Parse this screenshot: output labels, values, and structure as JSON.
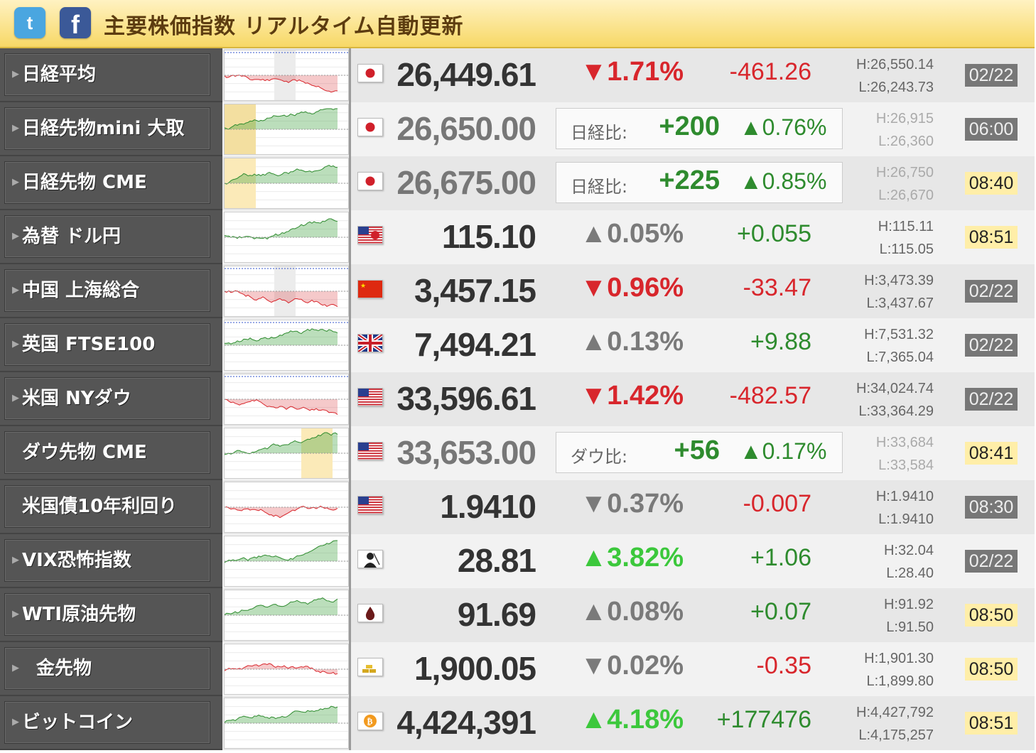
{
  "header": {
    "title": "主要株価指数 リアルタイム自動更新",
    "twitter_icon": "twitter-icon",
    "facebook_icon": "facebook-icon"
  },
  "colors": {
    "down": "#d8262c",
    "up": "#2e8b2e",
    "up_strong": "#3cc83c",
    "header_bg": "#f7d866"
  },
  "rows": [
    {
      "name": "日経平均",
      "flag": "jp",
      "price": "26,449.61",
      "pct": "▼1.71%",
      "pct_color": "red",
      "change": "-461.26",
      "change_color": "red",
      "high": "H:26,550.14",
      "low": "L:26,243.73",
      "time": "02/22",
      "time_state": "closed"
    },
    {
      "name": "日経先物mini 大取",
      "flag": "jp",
      "price": "26,650.00",
      "fut_label": "日経比:",
      "fut_value": "+200",
      "fut_pct": "▲0.76%",
      "high": "H:26,915",
      "low": "L:26,360",
      "time": "06:00",
      "time_state": "closed"
    },
    {
      "name": "日経先物 CME",
      "flag": "jp",
      "price": "26,675.00",
      "fut_label": "日経比:",
      "fut_value": "+225",
      "fut_pct": "▲0.85%",
      "high": "H:26,750",
      "low": "L:26,670",
      "time": "08:40",
      "time_state": "open"
    },
    {
      "name": "為替 ドル円",
      "flag": "usjp",
      "price": "115.10",
      "pct": "▲0.05%",
      "pct_color": "dark",
      "change": "+0.055",
      "change_color": "green",
      "high": "H:115.11",
      "low": "L:115.05",
      "time": "08:51",
      "time_state": "open"
    },
    {
      "name": "中国 上海総合",
      "flag": "cn",
      "price": "3,457.15",
      "pct": "▼0.96%",
      "pct_color": "red",
      "change": "-33.47",
      "change_color": "red",
      "high": "H:3,473.39",
      "low": "L:3,437.67",
      "time": "02/22",
      "time_state": "closed"
    },
    {
      "name": "英国 FTSE100",
      "flag": "uk",
      "price": "7,494.21",
      "pct": "▲0.13%",
      "pct_color": "dark",
      "change": "+9.88",
      "change_color": "green",
      "high": "H:7,531.32",
      "low": "L:7,365.04",
      "time": "02/22",
      "time_state": "closed"
    },
    {
      "name": "米国 NYダウ",
      "flag": "us",
      "price": "33,596.61",
      "pct": "▼1.42%",
      "pct_color": "red",
      "change": "-482.57",
      "change_color": "red",
      "high": "H:34,024.74",
      "low": "L:33,364.29",
      "time": "02/22",
      "time_state": "closed"
    },
    {
      "name": "ダウ先物 CME",
      "flag": "us",
      "price": "33,653.00",
      "fut_label": "ダウ比:",
      "fut_value": "+56",
      "fut_pct": "▲0.17%",
      "high": "H:33,684",
      "low": "L:33,584",
      "time": "08:41",
      "time_state": "open"
    },
    {
      "name": "米国債10年利回り",
      "flag": "us",
      "price": "1.9410",
      "pct": "▼0.37%",
      "pct_color": "dark",
      "change": "-0.007",
      "change_color": "red",
      "high": "H:1.9410",
      "low": "L:1.9410",
      "time": "08:30",
      "time_state": "closed"
    },
    {
      "name": "VIX恐怖指数",
      "flag": "vix",
      "price": "28.81",
      "pct": "▲3.82%",
      "pct_color": "lime",
      "change": "+1.06",
      "change_color": "green",
      "high": "H:32.04",
      "low": "L:28.40",
      "time": "02/22",
      "time_state": "closed"
    },
    {
      "name": "WTI原油先物",
      "flag": "oil",
      "price": "91.69",
      "pct": "▲0.08%",
      "pct_color": "dark",
      "change": "+0.07",
      "change_color": "green",
      "high": "H:91.92",
      "low": "L:91.50",
      "time": "08:50",
      "time_state": "open"
    },
    {
      "name": "金先物",
      "flag": "gold",
      "price": "1,900.05",
      "pct": "▼0.02%",
      "pct_color": "dark",
      "change": "-0.35",
      "change_color": "red",
      "high": "H:1,901.30",
      "low": "L:1,899.80",
      "time": "08:50",
      "time_state": "open"
    },
    {
      "name": "ビットコイン",
      "flag": "btc",
      "price": "4,424,391",
      "pct": "▲4.18%",
      "pct_color": "lime",
      "change": "+177476",
      "change_color": "green",
      "high": "H:4,427,792",
      "low": "L:4,175,257",
      "time": "08:51",
      "time_state": "open"
    }
  ]
}
